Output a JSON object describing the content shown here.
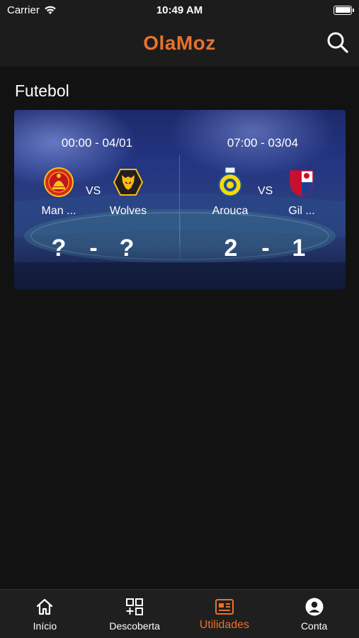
{
  "status_bar": {
    "carrier": "Carrier",
    "time": "10:49 AM"
  },
  "header": {
    "title": "OlaMoz",
    "search_icon": "search-icon"
  },
  "section": {
    "title": "Futebol"
  },
  "matches": [
    {
      "datetime": "00:00 - 04/01",
      "home": {
        "name": "Man ...",
        "logo": "manchester-united-logo"
      },
      "away": {
        "name": "Wolves",
        "logo": "wolves-logo"
      },
      "vs": "VS",
      "home_score": "?",
      "separator": "-",
      "away_score": "?"
    },
    {
      "datetime": "07:00 - 03/04",
      "home": {
        "name": "Arouca",
        "logo": "arouca-logo"
      },
      "away": {
        "name": "Gil ...",
        "logo": "gil-vicente-logo"
      },
      "vs": "VS",
      "home_score": "2",
      "separator": "-",
      "away_score": "1"
    }
  ],
  "tabs": [
    {
      "label": "Início",
      "icon": "home-icon",
      "active": false
    },
    {
      "label": "Descoberta",
      "icon": "grid-plus-icon",
      "active": false
    },
    {
      "label": "Utilidades",
      "icon": "newspaper-icon",
      "active": true
    },
    {
      "label": "Conta",
      "icon": "account-icon",
      "active": false
    }
  ],
  "colors": {
    "accent": "#e8722c",
    "background": "#121212",
    "bar": "#1c1c1c",
    "card": "#243582"
  }
}
